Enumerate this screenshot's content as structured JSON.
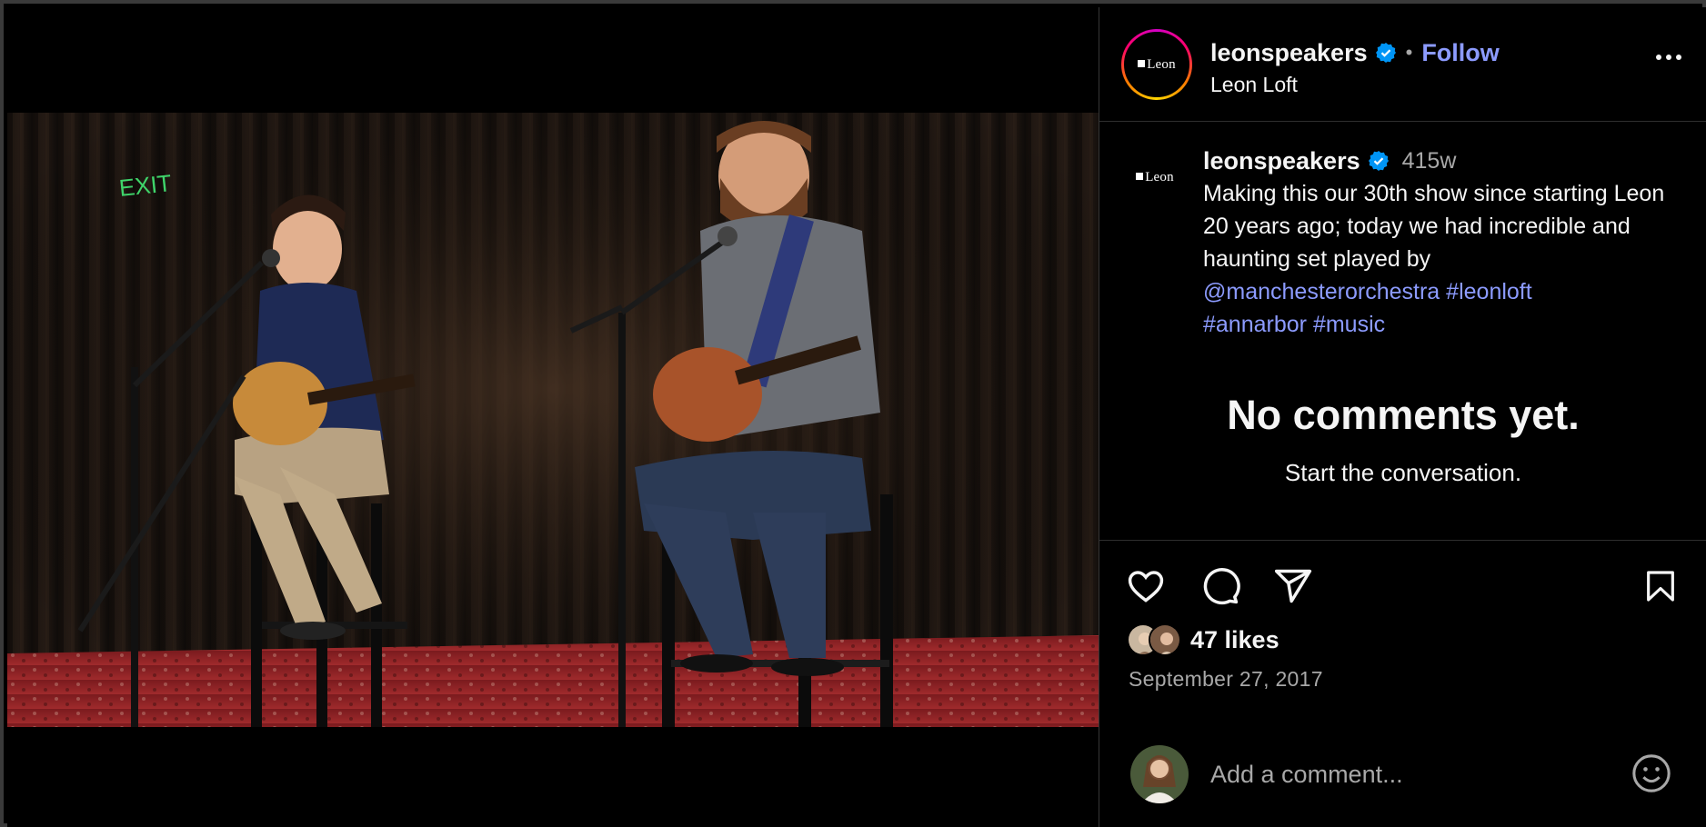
{
  "post": {
    "media": {
      "alt_icon": "mute-icon",
      "scene": "exit-sign"
    },
    "header": {
      "avatar_logo": "Leon",
      "username": "leonspeakers",
      "verified": true,
      "separator": "•",
      "follow_label": "Follow",
      "location": "Leon Loft",
      "more_icon": "more-icon"
    },
    "caption": {
      "avatar_logo": "Leon",
      "username": "leonspeakers",
      "time_ago": "415w",
      "text": "Making this our 30th show since starting Leon 20 years ago; today we had incredible and haunting set played by",
      "mention": "@manchesterorchestra",
      "hashtags": [
        "#leonloft",
        "#annarbor",
        "#music"
      ]
    },
    "comments": {
      "empty_title": "No comments yet.",
      "empty_subtitle": "Start the conversation."
    },
    "actions": {
      "icons": [
        "heart-icon",
        "comment-icon",
        "share-icon",
        "bookmark-icon"
      ]
    },
    "likes_label": "47 likes",
    "date": "September 27, 2017",
    "comment_box": {
      "placeholder": "Add a comment...",
      "emoji_icon": "emoji-icon"
    },
    "colors": {
      "link": "#8c9bff",
      "verified": "#0095f6",
      "background": "#000000",
      "secondary_text": "#a8a8a8"
    }
  }
}
